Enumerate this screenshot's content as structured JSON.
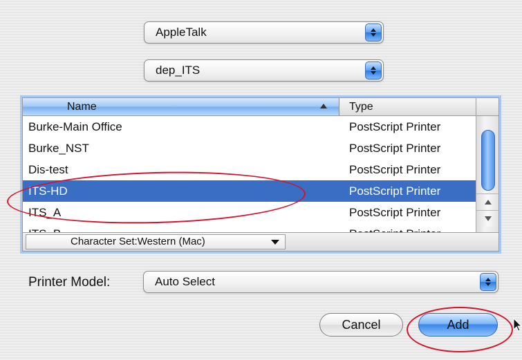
{
  "protocol_popup": {
    "value": "AppleTalk"
  },
  "zone_popup": {
    "value": "dep_ITS"
  },
  "printer_list": {
    "columns": {
      "name": "Name",
      "type": "Type"
    },
    "rows": [
      {
        "name": "Burke-Main Office",
        "type": "PostScript Printer"
      },
      {
        "name": "Burke_NST",
        "type": "PostScript Printer"
      },
      {
        "name": "Dis-test",
        "type": "PostScript Printer"
      },
      {
        "name": "ITS-HD",
        "type": "PostScript Printer"
      },
      {
        "name": "ITS_A",
        "type": "PostScript Printer"
      },
      {
        "name": "ITS_B",
        "type": "PostScript Printer"
      }
    ],
    "selected_row": "ITS-HD",
    "character_set": "Character Set:Western (Mac)"
  },
  "printer_model": {
    "label": "Printer Model:",
    "value": "Auto Select"
  },
  "buttons": {
    "cancel": "Cancel",
    "add": "Add"
  },
  "colors": {
    "selection": "#3a6ec4",
    "accent": "#5da2f3",
    "annotation": "#d8112b"
  }
}
